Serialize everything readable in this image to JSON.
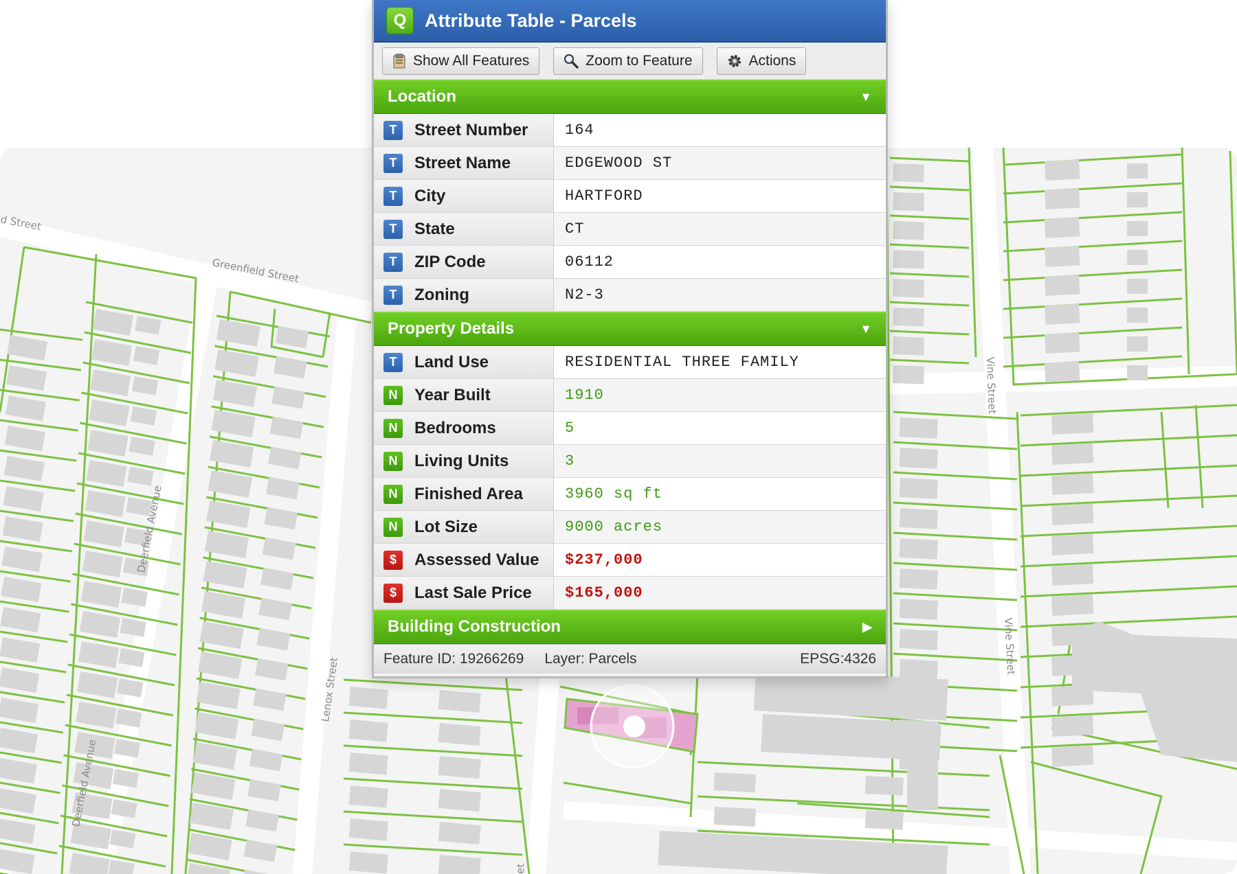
{
  "map": {
    "streets": {
      "street_partial": "d Street",
      "greenfield": "Greenfield Street",
      "deerfield_1": "Deerfield Avenue",
      "deerfield_2": "Deerfield Avenue",
      "lenox": "Lenox Street",
      "vine_1": "Vine Street",
      "vine_2": "Vine Street",
      "bottom_partial": "et"
    },
    "colors": {
      "parcel_outline": "#7cc242",
      "building": "#d6d6d6",
      "selected_parcel": "#e7a3cf",
      "background": "#f4f4f4"
    }
  },
  "panel": {
    "app_icon": "Q",
    "title": "Attribute Table - Parcels",
    "toolbar": {
      "show_all": {
        "label": "Show All Features",
        "icon": "clipboard-icon"
      },
      "zoom": {
        "label": "Zoom to Feature",
        "icon": "magnifier-icon"
      },
      "actions": {
        "label": "Actions",
        "icon": "gear-icon"
      }
    },
    "sections": {
      "location": {
        "label": "Location",
        "arrow": "▼"
      },
      "property": {
        "label": "Property Details",
        "arrow": "▼"
      },
      "building": {
        "label": "Building Construction",
        "arrow": "▶"
      }
    },
    "location_rows": [
      {
        "type": "T",
        "field": "Street Number",
        "value": "164"
      },
      {
        "type": "T",
        "field": "Street Name",
        "value": "EDGEWOOD ST"
      },
      {
        "type": "T",
        "field": "City",
        "value": "HARTFORD"
      },
      {
        "type": "T",
        "field": "State",
        "value": "CT"
      },
      {
        "type": "T",
        "field": "ZIP Code",
        "value": "06112"
      },
      {
        "type": "T",
        "field": "Zoning",
        "value": "N2-3"
      }
    ],
    "property_rows": [
      {
        "type": "T",
        "field": "Land Use",
        "value": "RESIDENTIAL THREE FAMILY"
      },
      {
        "type": "N",
        "field": "Year Built",
        "value": "1910"
      },
      {
        "type": "N",
        "field": "Bedrooms",
        "value": "5"
      },
      {
        "type": "N",
        "field": "Living Units",
        "value": "3"
      },
      {
        "type": "N",
        "field": "Finished Area",
        "value": "3960 sq ft"
      },
      {
        "type": "N",
        "field": "Lot Size",
        "value": "9000 acres"
      },
      {
        "type": "$",
        "field": "Assessed Value",
        "value": "$237,000"
      },
      {
        "type": "$",
        "field": "Last Sale Price",
        "value": "$165,000"
      }
    ],
    "status": {
      "feature_id": "Feature ID: 19266269",
      "layer": "Layer: Parcels",
      "crs": "EPSG:4326"
    }
  }
}
